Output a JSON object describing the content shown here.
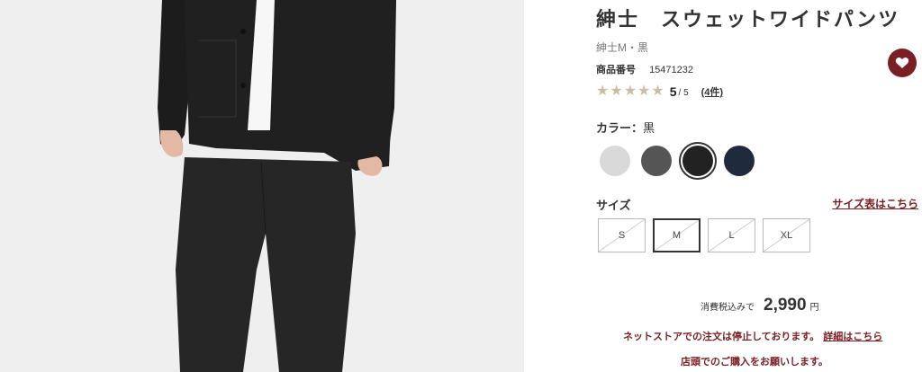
{
  "product": {
    "title": "紳士　スウェットワイドパンツ",
    "subtitle": "紳士M・黒",
    "sku_label": "商品番号",
    "sku_value": "15471232",
    "rating": {
      "stars": 5,
      "score": "5",
      "out_of": "/ 5",
      "reviews": "(4件)"
    }
  },
  "favorite": {
    "icon": "heart-icon"
  },
  "color": {
    "label": "カラー：",
    "selected": "黒",
    "swatches": [
      {
        "name": "light-gray",
        "hex": "#d9d9d9"
      },
      {
        "name": "charcoal",
        "hex": "#555555"
      },
      {
        "name": "black",
        "hex": "#222222"
      },
      {
        "name": "navy",
        "hex": "#1f2a3d"
      }
    ]
  },
  "size": {
    "label": "サイズ",
    "chart_link": "サイズ表はこちら",
    "options": [
      "S",
      "M",
      "L",
      "XL"
    ],
    "selected": "M"
  },
  "price": {
    "prefix": "消費税込みで",
    "amount": "2,990",
    "unit": "円"
  },
  "notices": {
    "line1": "ネットストアでの注文は停止しております。",
    "line1_link": "詳細はこちら",
    "line2": "店頭でのご購入をお願いします。"
  },
  "colors": {
    "accent": "#7a1f23",
    "star": "#c9bea1"
  }
}
